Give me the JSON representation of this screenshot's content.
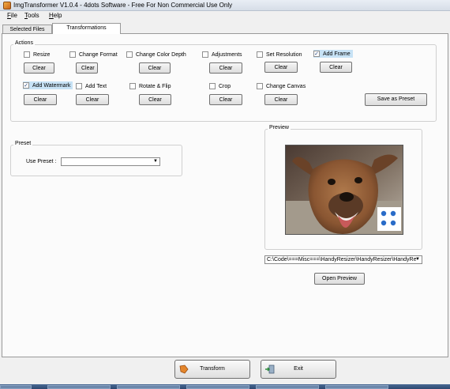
{
  "window": {
    "title": "ImgTransformer V1.0.4 - 4dots Software - Free For Non Commercial Use Only"
  },
  "menu": [
    "File",
    "Tools",
    "Help"
  ],
  "tabs": [
    "Selected Files",
    "Transformations"
  ],
  "actions": {
    "title": "Actions",
    "items": [
      {
        "label": "Resize",
        "checked": false
      },
      {
        "label": "Change Format",
        "checked": false
      },
      {
        "label": "Change Color Depth",
        "checked": false
      },
      {
        "label": "Adjustments",
        "checked": false
      },
      {
        "label": "Set Resolution",
        "checked": false
      },
      {
        "label": "Add Frame",
        "checked": true
      },
      {
        "label": "Add Watermark",
        "checked": true
      },
      {
        "label": "Add Text",
        "checked": false
      },
      {
        "label": "Rotate & Flip",
        "checked": false
      },
      {
        "label": "Crop",
        "checked": false
      },
      {
        "label": "Change Canvas",
        "checked": false
      }
    ],
    "clear_label": "Clear",
    "save_preset_label": "Save as Preset"
  },
  "preset": {
    "title": "Preset",
    "use_label": "Use Preset :",
    "value": ""
  },
  "preview": {
    "title": "Preview",
    "path": "C:\\Code\\===Misc===\\HandyResizer\\HandyResizer\\HandyRe",
    "open_label": "Open Preview"
  },
  "bottom": {
    "transform_label": "Transform",
    "exit_label": "Exit"
  },
  "colors": {
    "highlight": "#c7e2f5",
    "check": "#1f3f7a"
  }
}
